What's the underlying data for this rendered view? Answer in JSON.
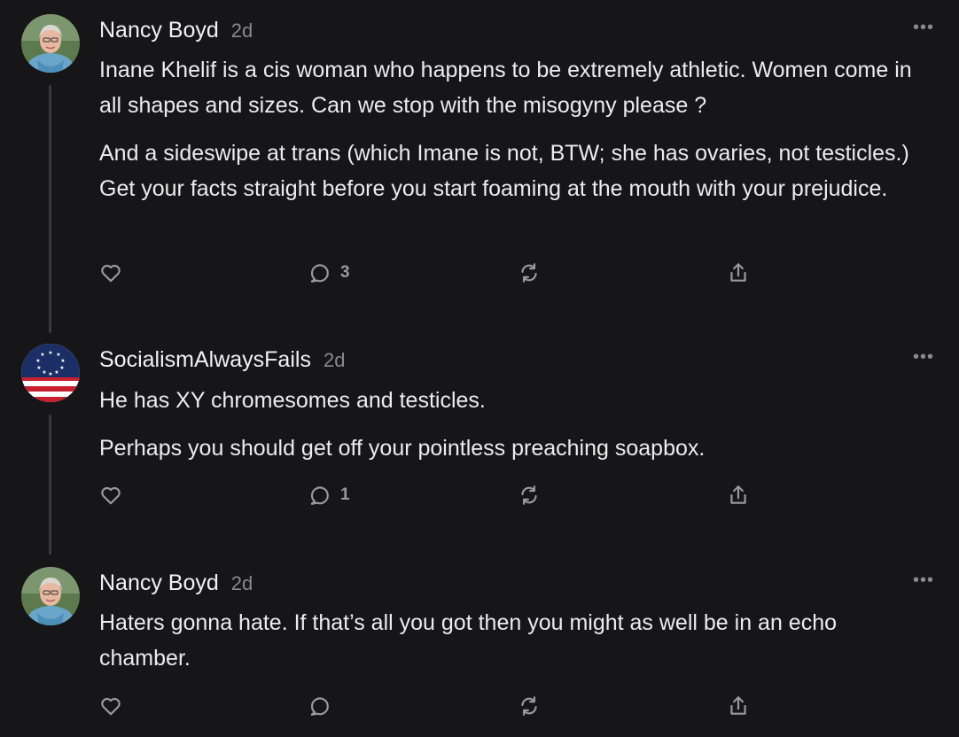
{
  "comments": [
    {
      "author": "Nancy Boyd",
      "time": "2d",
      "paragraphs": [
        "Inane Khelif is a cis woman who happens to be extremely athletic. Women come in all shapes and sizes. Can we stop with the misogyny please ?",
        "And a sideswipe at trans (which Imane is not, BTW; she has ovaries, not testicles.) Get your facts straight before you start foaming at the mouth with your prejudice."
      ],
      "reply_count": "3",
      "more_label": "•••"
    },
    {
      "author": "SocialismAlwaysFails",
      "time": "2d",
      "paragraphs": [
        "He has XY chromesomes and testicles.",
        "Perhaps you should get off your pointless preaching soapbox."
      ],
      "reply_count": "1",
      "more_label": "•••"
    },
    {
      "author": "Nancy Boyd",
      "time": "2d",
      "paragraphs": [
        "Haters gonna hate. If that’s all you got then you might as well be in an echo chamber."
      ],
      "reply_count": "",
      "more_label": "•••"
    }
  ],
  "icons": {
    "like": "heart-icon",
    "reply": "comment-bubble-icon",
    "restack": "restack-icon",
    "share": "share-icon",
    "more": "more-options-icon"
  },
  "colors": {
    "background": "#161618",
    "text": "#ececec",
    "muted": "#8a8a8e",
    "thread_line": "#3a3a3d"
  }
}
